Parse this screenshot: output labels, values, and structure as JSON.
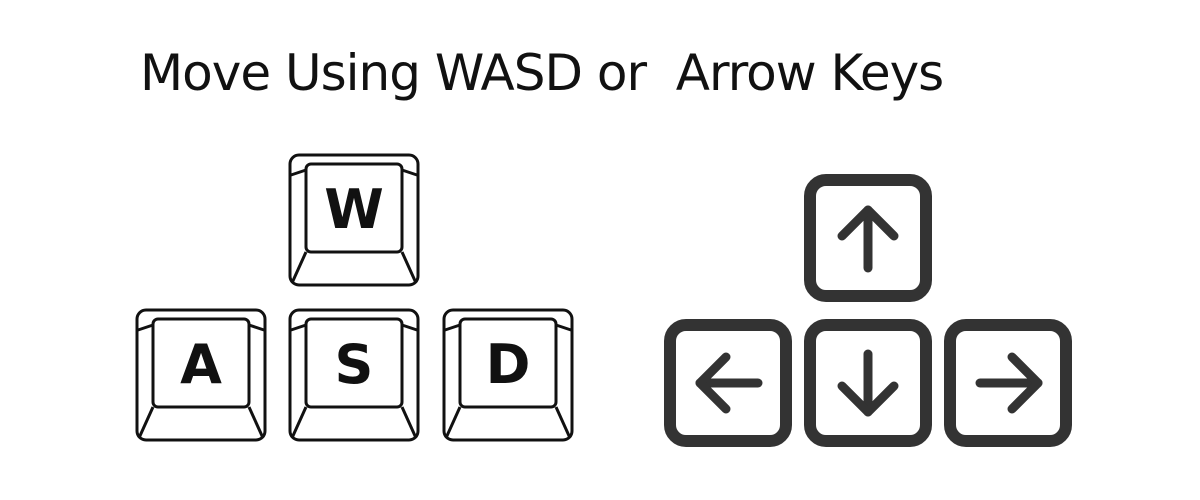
{
  "title": "Move Using WASD or  Arrow Keys",
  "wasd_keys": {
    "w": "W",
    "a": "A",
    "s": "S",
    "d": "D"
  },
  "arrow_keys": {
    "up": "arrow-up-icon",
    "left": "arrow-left-icon",
    "down": "arrow-down-icon",
    "right": "arrow-right-icon"
  },
  "colors": {
    "text": "#111111",
    "arrow_key_stroke": "#333333",
    "background": "#ffffff"
  }
}
